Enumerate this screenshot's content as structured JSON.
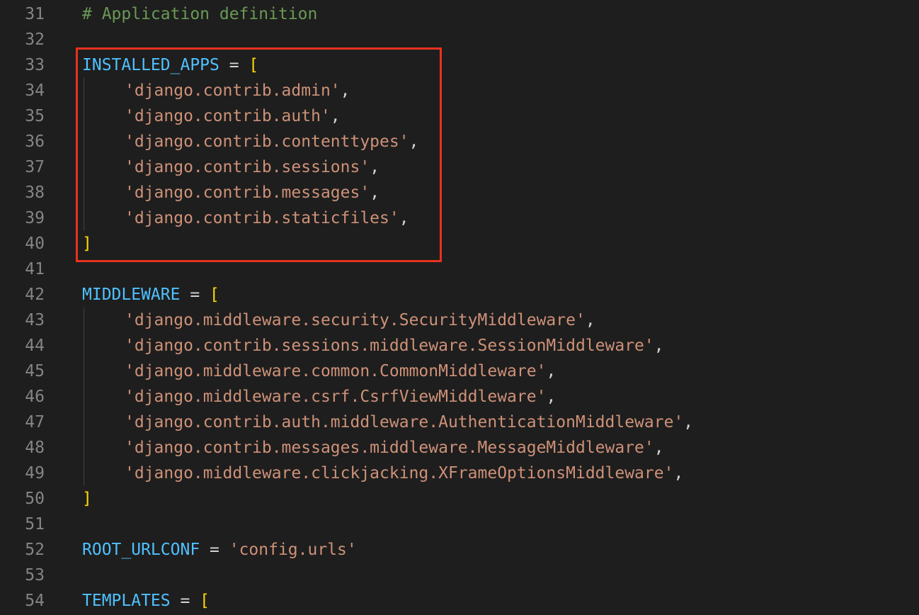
{
  "editor": {
    "lines": [
      {
        "n": "31",
        "kind": "comment",
        "text": "# Application definition"
      },
      {
        "n": "32",
        "kind": "blank"
      },
      {
        "n": "33",
        "kind": "assign",
        "var": "INSTALLED_APPS",
        "op": " = ",
        "bracket": "["
      },
      {
        "n": "34",
        "kind": "item",
        "str": "'django.contrib.admin'",
        "punct": ","
      },
      {
        "n": "35",
        "kind": "item",
        "str": "'django.contrib.auth'",
        "punct": ","
      },
      {
        "n": "36",
        "kind": "item",
        "str": "'django.contrib.contenttypes'",
        "punct": ","
      },
      {
        "n": "37",
        "kind": "item",
        "str": "'django.contrib.sessions'",
        "punct": ","
      },
      {
        "n": "38",
        "kind": "item",
        "str": "'django.contrib.messages'",
        "punct": ","
      },
      {
        "n": "39",
        "kind": "item",
        "str": "'django.contrib.staticfiles'",
        "punct": ","
      },
      {
        "n": "40",
        "kind": "close",
        "bracket": "]"
      },
      {
        "n": "41",
        "kind": "blank"
      },
      {
        "n": "42",
        "kind": "assign",
        "var": "MIDDLEWARE",
        "op": " = ",
        "bracket": "["
      },
      {
        "n": "43",
        "kind": "item",
        "str": "'django.middleware.security.SecurityMiddleware'",
        "punct": ","
      },
      {
        "n": "44",
        "kind": "item",
        "str": "'django.contrib.sessions.middleware.SessionMiddleware'",
        "punct": ","
      },
      {
        "n": "45",
        "kind": "item",
        "str": "'django.middleware.common.CommonMiddleware'",
        "punct": ","
      },
      {
        "n": "46",
        "kind": "item",
        "str": "'django.middleware.csrf.CsrfViewMiddleware'",
        "punct": ","
      },
      {
        "n": "47",
        "kind": "item",
        "str": "'django.contrib.auth.middleware.AuthenticationMiddleware'",
        "punct": ","
      },
      {
        "n": "48",
        "kind": "item",
        "str": "'django.contrib.messages.middleware.MessageMiddleware'",
        "punct": ","
      },
      {
        "n": "49",
        "kind": "item",
        "str": "'django.middleware.clickjacking.XFrameOptionsMiddleware'",
        "punct": ","
      },
      {
        "n": "50",
        "kind": "close",
        "bracket": "]"
      },
      {
        "n": "51",
        "kind": "blank"
      },
      {
        "n": "52",
        "kind": "assign_str",
        "var": "ROOT_URLCONF",
        "op": " = ",
        "str": "'config.urls'"
      },
      {
        "n": "53",
        "kind": "blank"
      },
      {
        "n": "54",
        "kind": "assign",
        "var": "TEMPLATES",
        "op": " = ",
        "bracket": "["
      }
    ]
  },
  "colors": {
    "background": "#1e1e1e",
    "line_number": "#858585",
    "comment": "#6a9955",
    "variable": "#4fc1ff",
    "string": "#ce9178",
    "bracket": "#ffd700",
    "highlight_box": "#e8321e"
  }
}
